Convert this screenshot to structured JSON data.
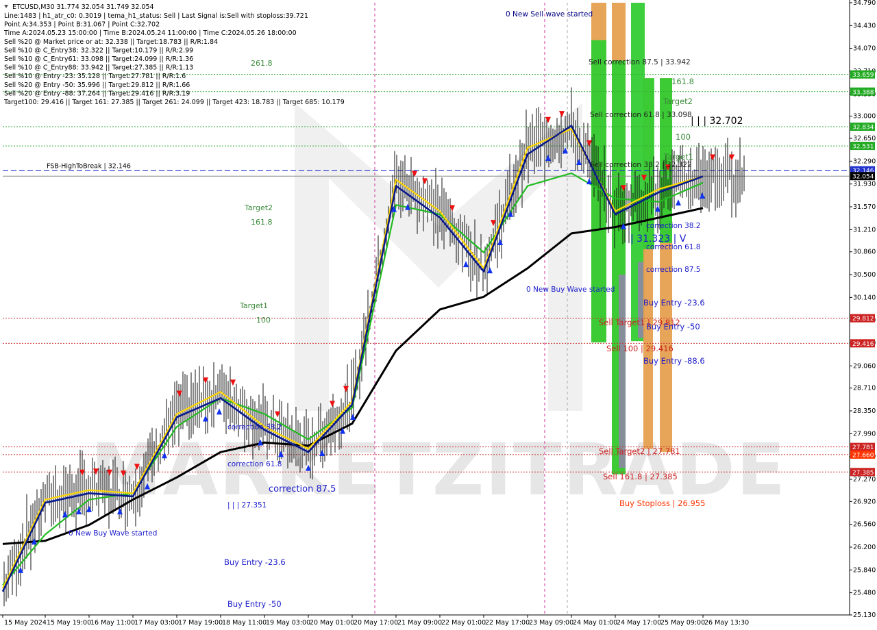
{
  "chart_data": {
    "type": "line",
    "symbol": "ETCUSD,M30",
    "ohlc": "31.774 32.054 31.749 32.054",
    "info_lines": [
      "Line:1483 | h1_atr_c0: 0.3019 | tema_h1_status: Sell | Last Signal is:Sell with stoploss:39.721",
      "Point A:34.353 | Point B:31.067 | Point C:32.702",
      "Time A:2024.05.23 15:00:00 | Time B:2024.05.24 11:00:00 | Time C:2024.05.26 18:00:00",
      "Sell %20 @ Market price or at: 32.338 || Target:18.783 || R/R:1.84",
      "Sell %10 @ C_Entry38: 32.322 || Target:10.179 || R/R:2.99",
      "Sell %10 @ C_Entry61: 33.098 || Target:24.099 || R/R:1.36",
      "Sell %10 @ C_Entry88: 33.942 || Target:27.385 || R/R:1.13",
      "Sell %10 @ Entry -23: 35.128 || Target:27.781 || R/R:1.6",
      "Sell %20 @ Entry -50: 35.996 || Target:29.812 || R/R:1.66",
      "Sell %20 @ Entry -88: 37.264 || Target:29.416 || R/R:3.19",
      "Target100: 29.416 || Target 161: 27.385 || Target 261: 24.099 || Target 423: 18.783 || Target 685: 10.179"
    ],
    "y_ticks": [
      "34.790",
      "34.430",
      "34.070",
      "33.710",
      "33.350",
      "33.000",
      "32.650",
      "32.290",
      "31.930",
      "31.570",
      "31.210",
      "30.860",
      "30.500",
      "30.140",
      "29.780",
      "29.420",
      "29.060",
      "28.710",
      "28.350",
      "27.990",
      "27.630",
      "27.270",
      "26.920",
      "26.560",
      "26.200",
      "25.840",
      "25.480",
      "25.130"
    ],
    "x_ticks": [
      "15 May 2024",
      "15 May 19:00",
      "16 May 11:00",
      "17 May 03:00",
      "17 May 19:00",
      "18 May 11:00",
      "19 May 03:00",
      "20 May 01:00",
      "20 May 17:00",
      "21 May 09:00",
      "22 May 01:00",
      "22 May 17:00",
      "23 May 09:00",
      "24 May 01:00",
      "24 May 17:00",
      "25 May 09:00",
      "26 May 13:30"
    ],
    "ylim": [
      25.13,
      34.79
    ],
    "price_tags": [
      {
        "value": 33.659,
        "text": "33.659",
        "color": "#22aa22"
      },
      {
        "value": 33.388,
        "text": "33.388",
        "color": "#22aa22"
      },
      {
        "value": 32.834,
        "text": "32.834",
        "color": "#22aa22"
      },
      {
        "value": 32.531,
        "text": "32.531",
        "color": "#22aa22"
      },
      {
        "value": 32.146,
        "text": "32.146",
        "color": "#2233cc"
      },
      {
        "value": 32.054,
        "text": "32.054",
        "color": "#000000"
      },
      {
        "value": 29.812,
        "text": "29.812",
        "color": "#cc2222"
      },
      {
        "value": 29.416,
        "text": "29.416",
        "color": "#cc2222"
      },
      {
        "value": 27.781,
        "text": "27.781",
        "color": "#cc2222"
      },
      {
        "value": 27.66,
        "text": "27.660",
        "color": "#ff3300"
      },
      {
        "value": 27.385,
        "text": "27.385",
        "color": "#cc2222"
      }
    ],
    "fsb_label": "FSB-HighToBreak | 32.146",
    "annotations": [
      {
        "text": "0 New Sell wave started",
        "color": "#000080"
      },
      {
        "text": "261.8",
        "color": "#3a8a3a"
      },
      {
        "text": "Target2",
        "color": "#3a8a3a"
      },
      {
        "text": "161.8",
        "color": "#3a8a3a"
      },
      {
        "text": "Target1",
        "color": "#3a8a3a"
      },
      {
        "text": "100",
        "color": "#3a8a3a"
      },
      {
        "text": "correction 38.2",
        "color": "#1a1acc"
      },
      {
        "text": "correction 61.8",
        "color": "#1a1acc"
      },
      {
        "text": "correction 87.5",
        "color": "#1a1acc"
      },
      {
        "text": "| | | 27.351",
        "color": "#1a1acc"
      },
      {
        "text": "0 New Buy Wave started",
        "color": "#1a1acc"
      },
      {
        "text": "Buy Entry -23.6",
        "color": "#1a1acc"
      },
      {
        "text": "Buy Entry -50",
        "color": "#1a1acc"
      },
      {
        "text": "0 New Buy Wave started",
        "color": "#1a1acc"
      },
      {
        "text": "Sell correction 87.5 | 33.942",
        "color": "#222222"
      },
      {
        "text": "Sell correction 61.8 | 33.098",
        "color": "#222222"
      },
      {
        "text": "Sell correction 38.2 | 32.322",
        "color": "#222222"
      },
      {
        "text": "161.8",
        "color": "#3a8a3a"
      },
      {
        "text": "Target2",
        "color": "#3a8a3a"
      },
      {
        "text": "| | | 32.702",
        "color": "#000000"
      },
      {
        "text": "100",
        "color": "#3a8a3a"
      },
      {
        "text": "Target1",
        "color": "#3a8a3a"
      },
      {
        "text": "correction 38.2",
        "color": "#1a1acc"
      },
      {
        "text": "| 31.323 | V",
        "color": "#1a1acc"
      },
      {
        "text": "correction 61.8",
        "color": "#1a1acc"
      },
      {
        "text": "correction 87.5",
        "color": "#1a1acc"
      },
      {
        "text": "Buy Entry -23.6",
        "color": "#1a1acc"
      },
      {
        "text": "Sell Target1 | 29.812",
        "color": "#cc2222"
      },
      {
        "text": "Buy Entry -50",
        "color": "#1a1acc"
      },
      {
        "text": "Sell 100 | 29.416",
        "color": "#cc2222"
      },
      {
        "text": "Buy Entry -88.6",
        "color": "#1a1acc"
      },
      {
        "text": "Sell Target2 | 27.781",
        "color": "#cc2222"
      },
      {
        "text": "Sell 161.8 | 27.385",
        "color": "#cc2222"
      },
      {
        "text": "Buy Stoploss | 26.955",
        "color": "#ff3300"
      }
    ],
    "series": [
      {
        "name": "",
        "color": "#000000",
        "x": [
          "15 May 2024",
          "15 May 19:00",
          "16 May 11:00",
          "17 May 03:00",
          "17 May 19:00",
          "18 May 11:00",
          "19 May 03:00",
          "20 May 01:00",
          "20 May 17:00",
          "21 May 09:00",
          "22 May 01:00",
          "22 May 17:00",
          "23 May 09:00",
          "24 May 01:00",
          "24 May 17:00",
          "25 May 09:00",
          "26 May 13:30"
        ],
        "values": [
          26.25,
          26.3,
          26.55,
          26.95,
          27.3,
          27.7,
          27.85,
          27.8,
          28.15,
          29.3,
          29.95,
          30.15,
          30.6,
          31.15,
          31.25,
          31.4,
          31.55
        ]
      },
      {
        "name": "",
        "color": "#22bb22",
        "x": [
          "15 May 2024",
          "15 May 19:00",
          "16 May 11:00",
          "17 May 03:00",
          "17 May 19:00",
          "18 May 11:00",
          "19 May 03:00",
          "20 May 01:00",
          "20 May 17:00",
          "21 May 09:00",
          "22 May 01:00",
          "22 May 17:00",
          "23 May 09:00",
          "24 May 01:00",
          "24 May 17:00",
          "25 May 09:00",
          "26 May 13:30"
        ],
        "values": [
          25.6,
          26.4,
          26.95,
          27.05,
          28.1,
          28.55,
          28.3,
          27.9,
          28.4,
          31.6,
          31.45,
          30.85,
          31.9,
          32.1,
          31.7,
          31.65,
          31.95
        ]
      },
      {
        "name": "",
        "color": "#ffd700",
        "x": [
          "15 May 2024",
          "15 May 19:00",
          "16 May 11:00",
          "17 May 03:00",
          "17 May 19:00",
          "18 May 11:00",
          "19 May 03:00",
          "20 May 01:00",
          "20 May 17:00",
          "21 May 09:00",
          "22 May 01:00",
          "22 May 17:00",
          "23 May 09:00",
          "24 May 01:00",
          "24 May 17:00",
          "25 May 09:00",
          "26 May 13:30"
        ],
        "values": [
          25.55,
          26.95,
          27.1,
          27.05,
          28.3,
          28.65,
          28.1,
          27.75,
          28.5,
          32.0,
          31.5,
          30.6,
          32.5,
          32.8,
          31.5,
          31.85,
          32.05
        ]
      },
      {
        "name": "",
        "color": "#0a1a8a",
        "x": [
          "15 May 2024",
          "15 May 19:00",
          "16 May 11:00",
          "17 May 03:00",
          "17 May 19:00",
          "18 May 11:00",
          "19 May 03:00",
          "20 May 01:00",
          "20 May 17:00",
          "21 May 09:00",
          "22 May 01:00",
          "22 May 17:00",
          "23 May 09:00",
          "24 May 01:00",
          "24 May 17:00",
          "25 May 09:00",
          "26 May 13:30"
        ],
        "values": [
          25.5,
          26.9,
          27.05,
          27.0,
          28.25,
          28.55,
          28.05,
          27.7,
          28.45,
          31.9,
          31.4,
          30.55,
          32.4,
          32.85,
          31.45,
          31.8,
          32.05
        ]
      }
    ]
  },
  "watermark": "MARKETZITRADE",
  "colors": {
    "green_zone": "#33cc33",
    "orange_zone": "#e5a050",
    "grey_zone": "#8a8aa0",
    "background": "#ffffff"
  }
}
